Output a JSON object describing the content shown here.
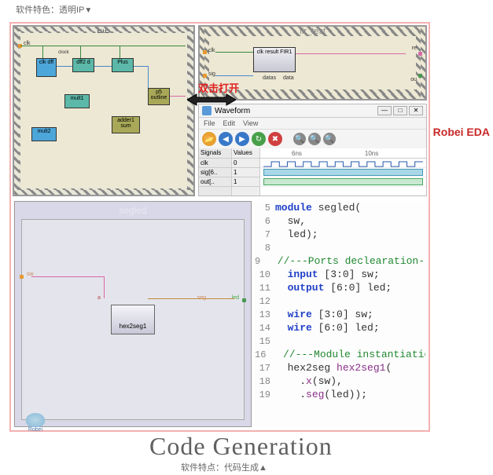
{
  "labels": {
    "top": "软件特色：透明IP",
    "top_arrow": "▼",
    "bottom": "软件特点：代码生成",
    "bottom_arrow": "▲",
    "brand": "Robei EDA",
    "code_gen": "Code Generation",
    "double_click": "双击打开",
    "robei_logo": "Robei"
  },
  "fir_panel": {
    "title": "FIR",
    "port_clk": "clk",
    "blocks": {
      "clk_dff": "clk\ndff",
      "clock": "clock",
      "dff2": "dff2 d",
      "plus": "Plus",
      "mult1": "mult1",
      "mult2": "mult2",
      "adder1": "adder1\nsum",
      "p5_outline": "p5\noutline"
    }
  },
  "fir_test": {
    "title": "fir_test",
    "port_clk": "clk",
    "port_sig": "sig",
    "port_result": "result",
    "port_data": "data",
    "port_datas": "datas",
    "block_fir": "clk result\nFIR1",
    "port_re": "re",
    "port_out": "ou"
  },
  "waveform": {
    "title": "Waveform",
    "menu": [
      "File",
      "Edit",
      "View"
    ],
    "signal_hdr": "Signals",
    "value_hdr": "Values",
    "times": [
      "6ns",
      "10ns"
    ],
    "signals": [
      {
        "name": "clk",
        "value": "0"
      },
      {
        "name": "sig[6..",
        "value": "1"
      },
      {
        "name": "out[..",
        "value": "1"
      }
    ],
    "win_btns": [
      "—",
      "□",
      "✕"
    ]
  },
  "segled": {
    "title": "segled",
    "port_sw": "sw",
    "port_a": "a",
    "port_seg": "seg",
    "port_led": "led",
    "block": "hex2seg1"
  },
  "code": {
    "lines": [
      {
        "n": 5,
        "parts": [
          {
            "t": "module ",
            "c": "kw"
          },
          {
            "t": "segled(",
            "c": "ident"
          }
        ]
      },
      {
        "n": 6,
        "parts": [
          {
            "t": "  sw,",
            "c": "ident"
          }
        ]
      },
      {
        "n": 7,
        "parts": [
          {
            "t": "  led);",
            "c": "ident"
          }
        ]
      },
      {
        "n": 8,
        "parts": [
          {
            "t": "",
            "c": ""
          }
        ]
      },
      {
        "n": 9,
        "parts": [
          {
            "t": "  //---Ports declearation---",
            "c": "comment"
          }
        ]
      },
      {
        "n": 10,
        "parts": [
          {
            "t": "  input ",
            "c": "type"
          },
          {
            "t": "[3:0] sw;",
            "c": "ident"
          }
        ]
      },
      {
        "n": 11,
        "parts": [
          {
            "t": "  output ",
            "c": "type"
          },
          {
            "t": "[6:0] led;",
            "c": "ident"
          }
        ]
      },
      {
        "n": 12,
        "parts": [
          {
            "t": "",
            "c": ""
          }
        ]
      },
      {
        "n": 13,
        "parts": [
          {
            "t": "  wire ",
            "c": "type"
          },
          {
            "t": "[3:0] sw;",
            "c": "ident"
          }
        ]
      },
      {
        "n": 14,
        "parts": [
          {
            "t": "  wire ",
            "c": "type"
          },
          {
            "t": "[6:0] led;",
            "c": "ident"
          }
        ]
      },
      {
        "n": 15,
        "parts": [
          {
            "t": "",
            "c": ""
          }
        ]
      },
      {
        "n": 16,
        "parts": [
          {
            "t": "  //---Module instantiation---",
            "c": "comment"
          }
        ]
      },
      {
        "n": 17,
        "parts": [
          {
            "t": "  hex2seg ",
            "c": "ident"
          },
          {
            "t": "hex2seg1",
            "c": "inst"
          },
          {
            "t": "(",
            "c": "ident"
          }
        ]
      },
      {
        "n": 18,
        "parts": [
          {
            "t": "    .",
            "c": "ident"
          },
          {
            "t": "x",
            "c": "inst"
          },
          {
            "t": "(sw),",
            "c": "ident"
          }
        ]
      },
      {
        "n": 19,
        "parts": [
          {
            "t": "    .",
            "c": "ident"
          },
          {
            "t": "seg",
            "c": "inst"
          },
          {
            "t": "(led));",
            "c": "ident"
          }
        ]
      }
    ]
  }
}
